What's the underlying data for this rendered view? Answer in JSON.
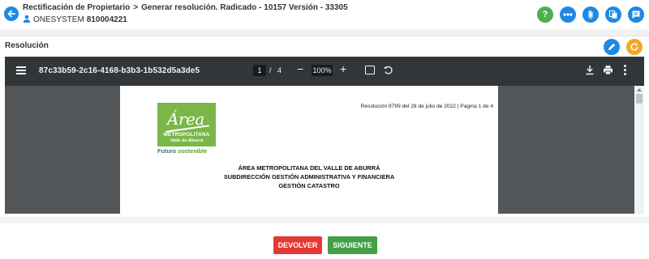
{
  "header": {
    "breadcrumb_parent": "Rectificación de Propietario",
    "breadcrumb_separator": ">",
    "breadcrumb_current": "Generar resolución. Radicado - 10157 Versión - 33305",
    "user_name": "ONESYSTEM",
    "user_code": "810004221",
    "help_label": "?"
  },
  "panel": {
    "title": "Resolución"
  },
  "pdf_viewer": {
    "document_name": "87c33b59-2c16-4168-b3b3-1b532d5a3de5",
    "current_page": "1",
    "page_separator": "/",
    "total_pages": "4",
    "zoom": "100%",
    "zoom_out_label": "−",
    "zoom_in_label": "+"
  },
  "document": {
    "logo_word": "Área",
    "logo_line1": "METROPOLITANA",
    "logo_line2": "Valle de Aburrá",
    "logo_tagline_1": "Futuro",
    "logo_tagline_2": "sostenible",
    "resolution_line": "Resolución 8799 del 28 de julio de 2022 | Pagina 1 de 4",
    "heading_1": "ÁREA METROPOLITANA DEL VALLE DE ABURRÁ",
    "heading_2": "SUBDIRECCIÓN GESTIÓN ADMINISTRATIVA Y FINANCIERA",
    "heading_3": "GESTIÓN CATASTRO"
  },
  "footer": {
    "return_label": "DEVOLVER",
    "next_label": "SIGUIENTE"
  },
  "colors": {
    "primary": "#1e88e5",
    "help": "#4caf50",
    "refresh": "#f5a623",
    "return": "#e53935",
    "next": "#43a047",
    "logo_green": "#7ab648"
  },
  "icons": [
    "back-arrow-icon",
    "user-icon",
    "help-icon",
    "more-horizontal-icon",
    "attachment-icon",
    "copy-icon",
    "comment-icon",
    "edit-icon",
    "refresh-icon",
    "menu-icon",
    "fit-page-icon",
    "rotate-icon",
    "download-icon",
    "print-icon",
    "more-vertical-icon"
  ]
}
